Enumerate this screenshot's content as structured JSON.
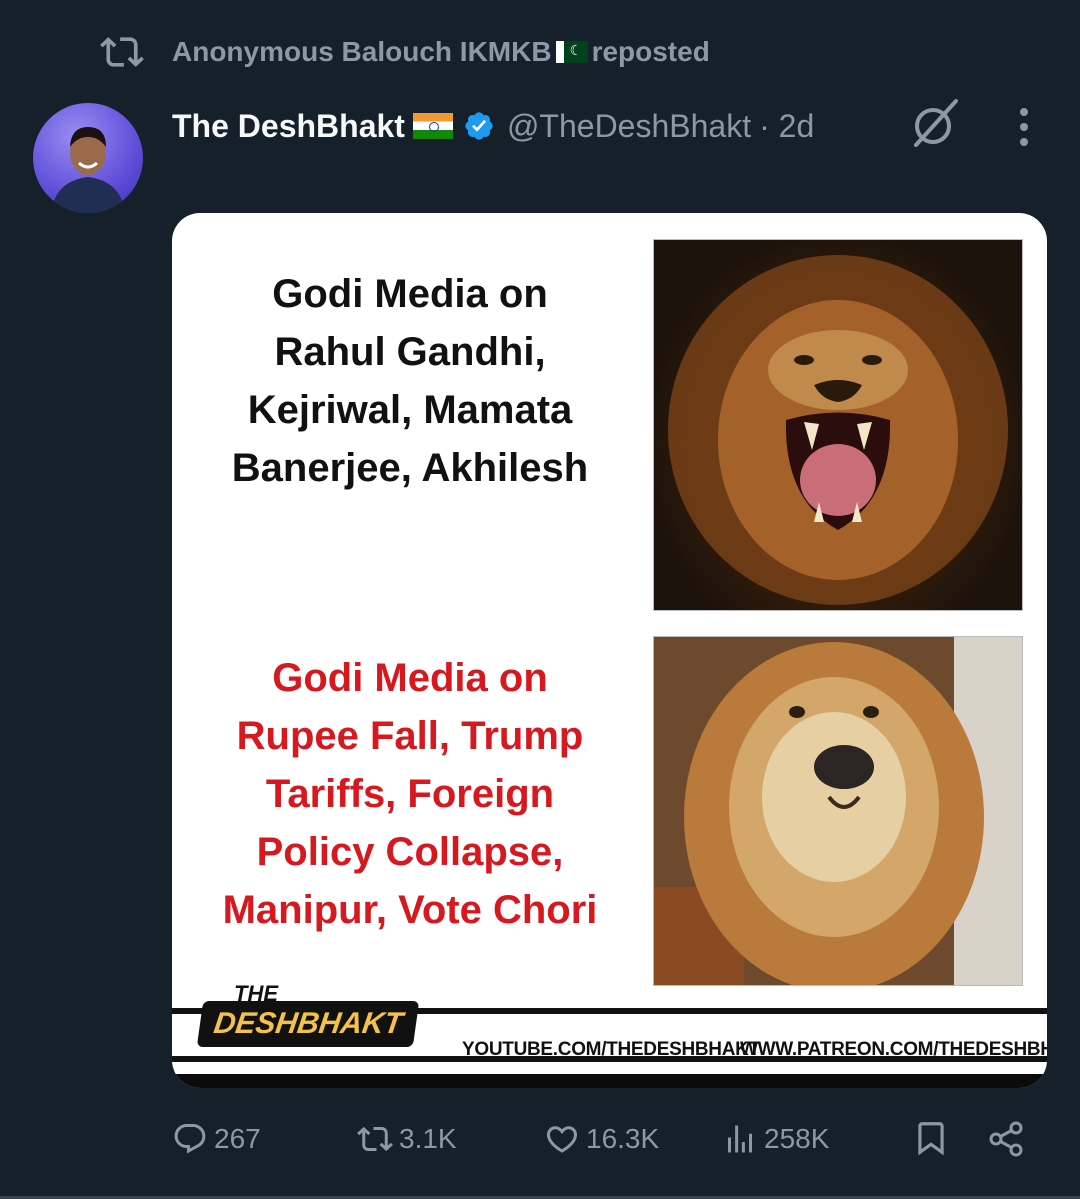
{
  "repost": {
    "label": "Anonymous Balouch IKMKB",
    "suffix": "reposted"
  },
  "post": {
    "display_name": "The DeshBhakt",
    "handle": "@TheDeshBhakt",
    "time": "· 2d"
  },
  "image": {
    "top_text_lines": [
      "Godi Media on",
      "Rahul Gandhi,",
      "Kejriwal, Mamata",
      "Banerjee, Akhilesh"
    ],
    "bottom_text_lines": [
      "Godi Media on",
      "Rupee Fall, Trump",
      "Tariffs, Foreign",
      "Policy Collapse,",
      "Manipur, Vote Chori"
    ],
    "logo_the": "THE",
    "logo_brand": "DESHBHAKT",
    "url_youtube": "YOUTUBE.COM/THEDESHBHAKT",
    "url_patreon": "WWW.PATREON.COM/THEDESHBHAKT"
  },
  "actions": {
    "replies": "267",
    "reposts": "3.1K",
    "likes": "16.3K",
    "views": "258K"
  },
  "icons": [
    "repost-icon",
    "verified-badge-icon",
    "grok-icon",
    "more-icon",
    "reply-icon",
    "like-icon",
    "views-icon",
    "bookmark-icon",
    "share-icon"
  ],
  "colors": {
    "background": "#15202b",
    "secondary_text": "#8b98a5",
    "verified": "#1d9bf0",
    "red_text": "#d7181e"
  }
}
